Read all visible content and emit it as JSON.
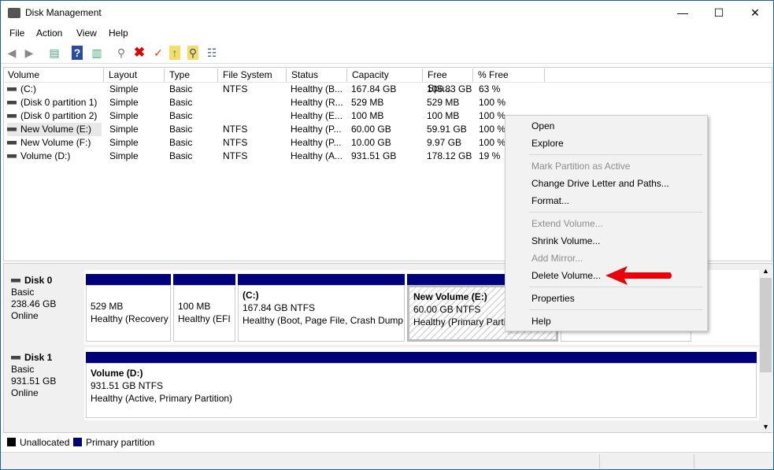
{
  "window": {
    "title": "Disk Management",
    "minimize": "—",
    "maximize": "☐",
    "close": "✕"
  },
  "menu": [
    "File",
    "Action",
    "View",
    "Help"
  ],
  "toolbar": [
    "back-icon",
    "forward-icon",
    "console-tree-icon",
    "help-icon",
    "action-pane-icon",
    "connect-icon",
    "delete-icon",
    "check-icon",
    "folder-up-icon",
    "folder-search-icon",
    "properties-icon"
  ],
  "columns": [
    "Volume",
    "Layout",
    "Type",
    "File System",
    "Status",
    "Capacity",
    "Free Spa...",
    "% Free"
  ],
  "rows": [
    [
      "(C:)",
      "Simple",
      "Basic",
      "NTFS",
      "Healthy (B...",
      "167.84 GB",
      "105.83 GB",
      "63 %"
    ],
    [
      "(Disk 0 partition 1)",
      "Simple",
      "Basic",
      "",
      "Healthy (R...",
      "529 MB",
      "529 MB",
      "100 %"
    ],
    [
      "(Disk 0 partition 2)",
      "Simple",
      "Basic",
      "",
      "Healthy (E...",
      "100 MB",
      "100 MB",
      "100 %"
    ],
    [
      "New Volume (E:)",
      "Simple",
      "Basic",
      "NTFS",
      "Healthy (P...",
      "60.00 GB",
      "59.91 GB",
      "100 %"
    ],
    [
      "New Volume (F:)",
      "Simple",
      "Basic",
      "NTFS",
      "Healthy (P...",
      "10.00 GB",
      "9.97 GB",
      "100 %"
    ],
    [
      "Volume (D:)",
      "Simple",
      "Basic",
      "NTFS",
      "Healthy (A...",
      "931.51 GB",
      "178.12 GB",
      "19 %"
    ]
  ],
  "disks": [
    {
      "name": "Disk 0",
      "type": "Basic",
      "size": "238.46 GB",
      "state": "Online",
      "partitions": [
        {
          "title": "",
          "size": "529 MB",
          "status": "Healthy (Recovery"
        },
        {
          "title": "",
          "size": "100 MB",
          "status": "Healthy (EFI"
        },
        {
          "title": "(C:)",
          "size": "167.84 GB NTFS",
          "status": "Healthy (Boot, Page File, Crash Dump"
        },
        {
          "title": "New Volume  (E:)",
          "size": "60.00 GB NTFS",
          "status": "Healthy (Primary Partition"
        },
        {
          "title": "",
          "size": "",
          "status": ""
        }
      ]
    },
    {
      "name": "Disk 1",
      "type": "Basic",
      "size": "931.51 GB",
      "state": "Online",
      "partitions": [
        {
          "title": "Volume  (D:)",
          "size": "931.51 GB NTFS",
          "status": "Healthy (Active, Primary Partition)"
        }
      ]
    }
  ],
  "legend": [
    {
      "label": "Unallocated",
      "color": "#000000"
    },
    {
      "label": "Primary partition",
      "color": "#00007b"
    }
  ],
  "context_menu": [
    {
      "label": "Open",
      "enabled": true
    },
    {
      "label": "Explore",
      "enabled": true
    },
    {
      "label": "Mark Partition as Active",
      "enabled": false
    },
    {
      "label": "Change Drive Letter and Paths...",
      "enabled": true
    },
    {
      "label": "Format...",
      "enabled": true
    },
    {
      "label": "Extend Volume...",
      "enabled": false
    },
    {
      "label": "Shrink Volume...",
      "enabled": true
    },
    {
      "label": "Add Mirror...",
      "enabled": false
    },
    {
      "label": "Delete Volume...",
      "enabled": true
    },
    {
      "label": "Properties",
      "enabled": true
    },
    {
      "label": "Help",
      "enabled": true
    }
  ],
  "colors": {
    "primary_partition": "#00007b",
    "arrow": "#e8000b"
  }
}
